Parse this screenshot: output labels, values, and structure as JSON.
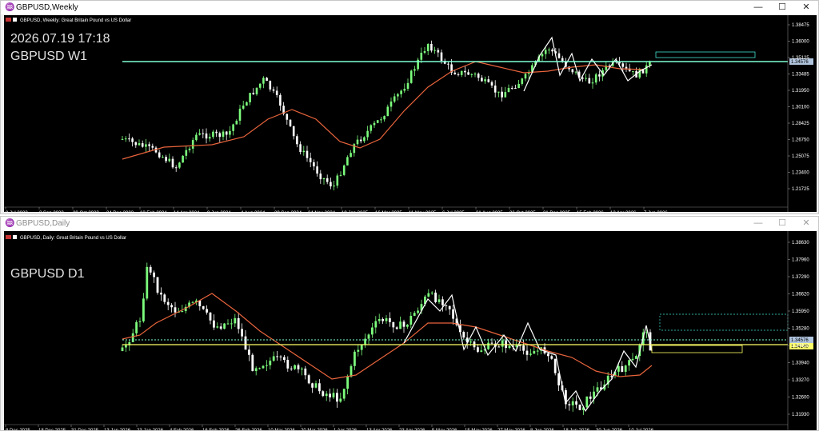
{
  "top_window": {
    "title": "GBPUSD,Weekly",
    "chart_header": "GBPUSD, Weekly:  Great Britain Pound vs US Dollar",
    "overlay_datetime": "2026.07.19 17:18",
    "overlay_symbol": "GBPUSD W1",
    "price_labels": [
      "1.38475",
      "1.36000",
      "1.35125",
      "1.33485",
      "1.31950",
      "1.30100",
      "1.28425",
      "1.26750",
      "1.25075",
      "1.23400",
      "1.21725"
    ],
    "current_price": "1.34576",
    "date_labels": [
      "9 Jul 2023",
      "3 Sep 2023",
      "29 Oct 2023",
      "24 Dec 2023",
      "18 Feb 2024",
      "14 Apr 2024",
      "9 Jun 2024",
      "4 Aug 2024",
      "29 Sep 2024",
      "24 Nov 2024",
      "19 Jan 2025",
      "16 Mar 2025",
      "11 May 2025",
      "6 Jul 2025",
      "31 Aug 2025",
      "26 Oct 2025",
      "21 Dec 2025",
      "15 Feb 2026",
      "12 Apr 2026",
      "7 Jun 2026"
    ]
  },
  "bottom_window": {
    "title": "GBPUSD,Daily",
    "chart_header": "GBPUSD, Daily:  Great Britain Pound vs US Dollar",
    "overlay_symbol": "GBPUSD D1",
    "price_labels": [
      "1.38630",
      "1.37960",
      "1.37290",
      "1.36620",
      "1.35950",
      "1.35280",
      "1.34610",
      "1.33940",
      "1.33270",
      "1.32600",
      "1.31930"
    ],
    "current_price": "1.34576",
    "yellow_price": "1.34140",
    "date_labels": [
      "8 Dec 2025",
      "18 Dec 2025",
      "31 Dec 2025",
      "13 Jan 2026",
      "23 Jan 2026",
      "4 Feb 2026",
      "16 Feb 2026",
      "26 Feb 2026",
      "10 Mar 2026",
      "20 Mar 2026",
      "1 Apr 2026",
      "13 Apr 2026",
      "23 Apr 2026",
      "5 May 2026",
      "15 May 2026",
      "27 May 2026",
      "8 Jun 2026",
      "18 Jun 2026",
      "30 Jun 2026",
      "10 Jul 2026"
    ]
  },
  "window_controls": {
    "minimize": "—",
    "maximize": "☐",
    "close": "✕"
  },
  "colors": {
    "background": "#000000",
    "bull": "#7cfc7c",
    "bear": "#ffffff",
    "moving_average": "#e8643c",
    "zigzag": "#ffffff",
    "level_line": "#7fffd4",
    "yellow_line": "#ffff66",
    "box": "#40e0d0"
  }
}
